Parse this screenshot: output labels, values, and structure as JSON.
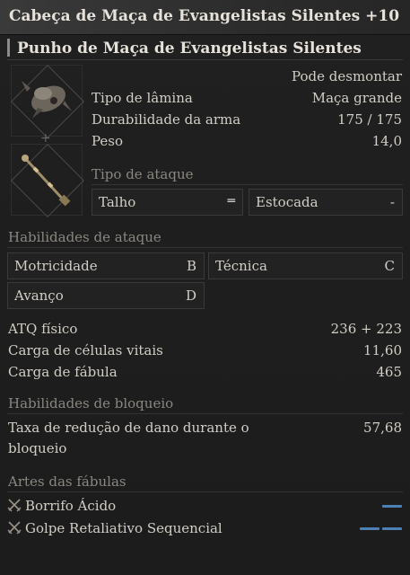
{
  "header": {
    "title": "Cabeça de Maça de Evangelistas Silentes +10",
    "subtitle": "Punho de Maça de Evangelistas Silentes"
  },
  "item": {
    "disassemble": "Pode desmontar",
    "blade_type_label": "Tipo de lâmina",
    "blade_type_value": "Maça grande",
    "durability_label": "Durabilidade da arma",
    "durability_value": "175 / 175",
    "weight_label": "Peso",
    "weight_value": "14,0"
  },
  "attack_type": {
    "heading": "Tipo de ataque",
    "left": "Talho",
    "separator": "═",
    "right": "Estocada",
    "right_value": "-"
  },
  "attack_abilities": {
    "heading": "Habilidades de ataque",
    "items": [
      {
        "label": "Motricidade",
        "grade": "B"
      },
      {
        "label": "Técnica",
        "grade": "C"
      },
      {
        "label": "Avanço",
        "grade": "D"
      }
    ]
  },
  "stats": [
    {
      "label": "ATQ físico",
      "value": "236 + 223"
    },
    {
      "label": "Carga de células vitais",
      "value": "11,60"
    },
    {
      "label": "Carga de fábula",
      "value": "465"
    }
  ],
  "block": {
    "heading": "Habilidades de bloqueio",
    "label_line1": "Taxa de redução de dano durante o",
    "label_line2": "bloqueio",
    "value": "57,68"
  },
  "fable_arts": {
    "heading": "Artes das fábulas",
    "items": [
      {
        "name": "Borrifo Ácido",
        "icon": "crossed-swords-icon",
        "slots": 1
      },
      {
        "name": "Golpe Retaliativo Sequencial",
        "icon": "crossed-swords-icon",
        "slots": 2
      }
    ]
  },
  "colors": {
    "accent_bar": "#4d7fb3",
    "background": "#1b1b1b"
  }
}
